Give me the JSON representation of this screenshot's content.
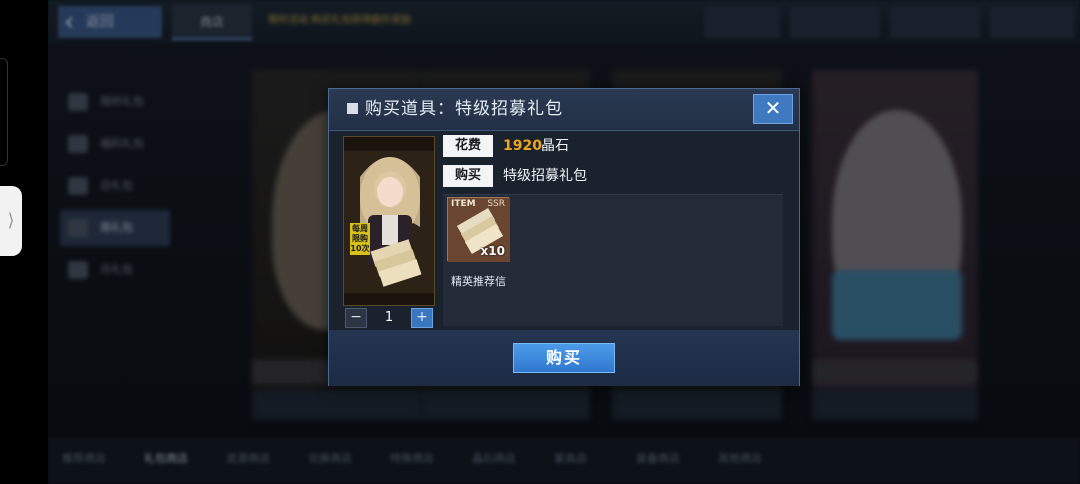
{
  "background": {
    "back_label": "返回",
    "top_tab": "商店",
    "notice": "限时活动 购买礼包获得额外奖励",
    "side_menu": [
      "限时礼包",
      "福利礼包",
      "日礼包",
      "周礼包",
      "月礼包"
    ],
    "bottom_tabs": [
      "推荐商店",
      "礼包商店",
      "资源商店",
      "兑换商店",
      "特殊商店",
      "晶石商店",
      "家具店",
      "装备商店",
      "其他商店"
    ]
  },
  "modal": {
    "title": "购买道具：特级招募礼包",
    "close_glyph": "✕",
    "cost_label": "花费",
    "cost_amount": "1920",
    "cost_currency": "晶石",
    "buy_label": "购买",
    "buy_item_name": "特级招募礼包",
    "preview_badge": "每周限购10次",
    "quantity": "1",
    "minus_glyph": "−",
    "plus_glyph": "+",
    "item": {
      "tag": "ITEM",
      "rarity": "SSR",
      "count": "x10",
      "name": "精英推荐信"
    },
    "confirm_label": "购买"
  },
  "colors": {
    "accent_blue": "#3f79c0",
    "cost_orange": "#f0a51f",
    "panel_bg": "#1b2431"
  },
  "icons": [
    "chevron-left-icon",
    "close-icon",
    "minus-icon",
    "plus-icon",
    "ticket-icon"
  ]
}
